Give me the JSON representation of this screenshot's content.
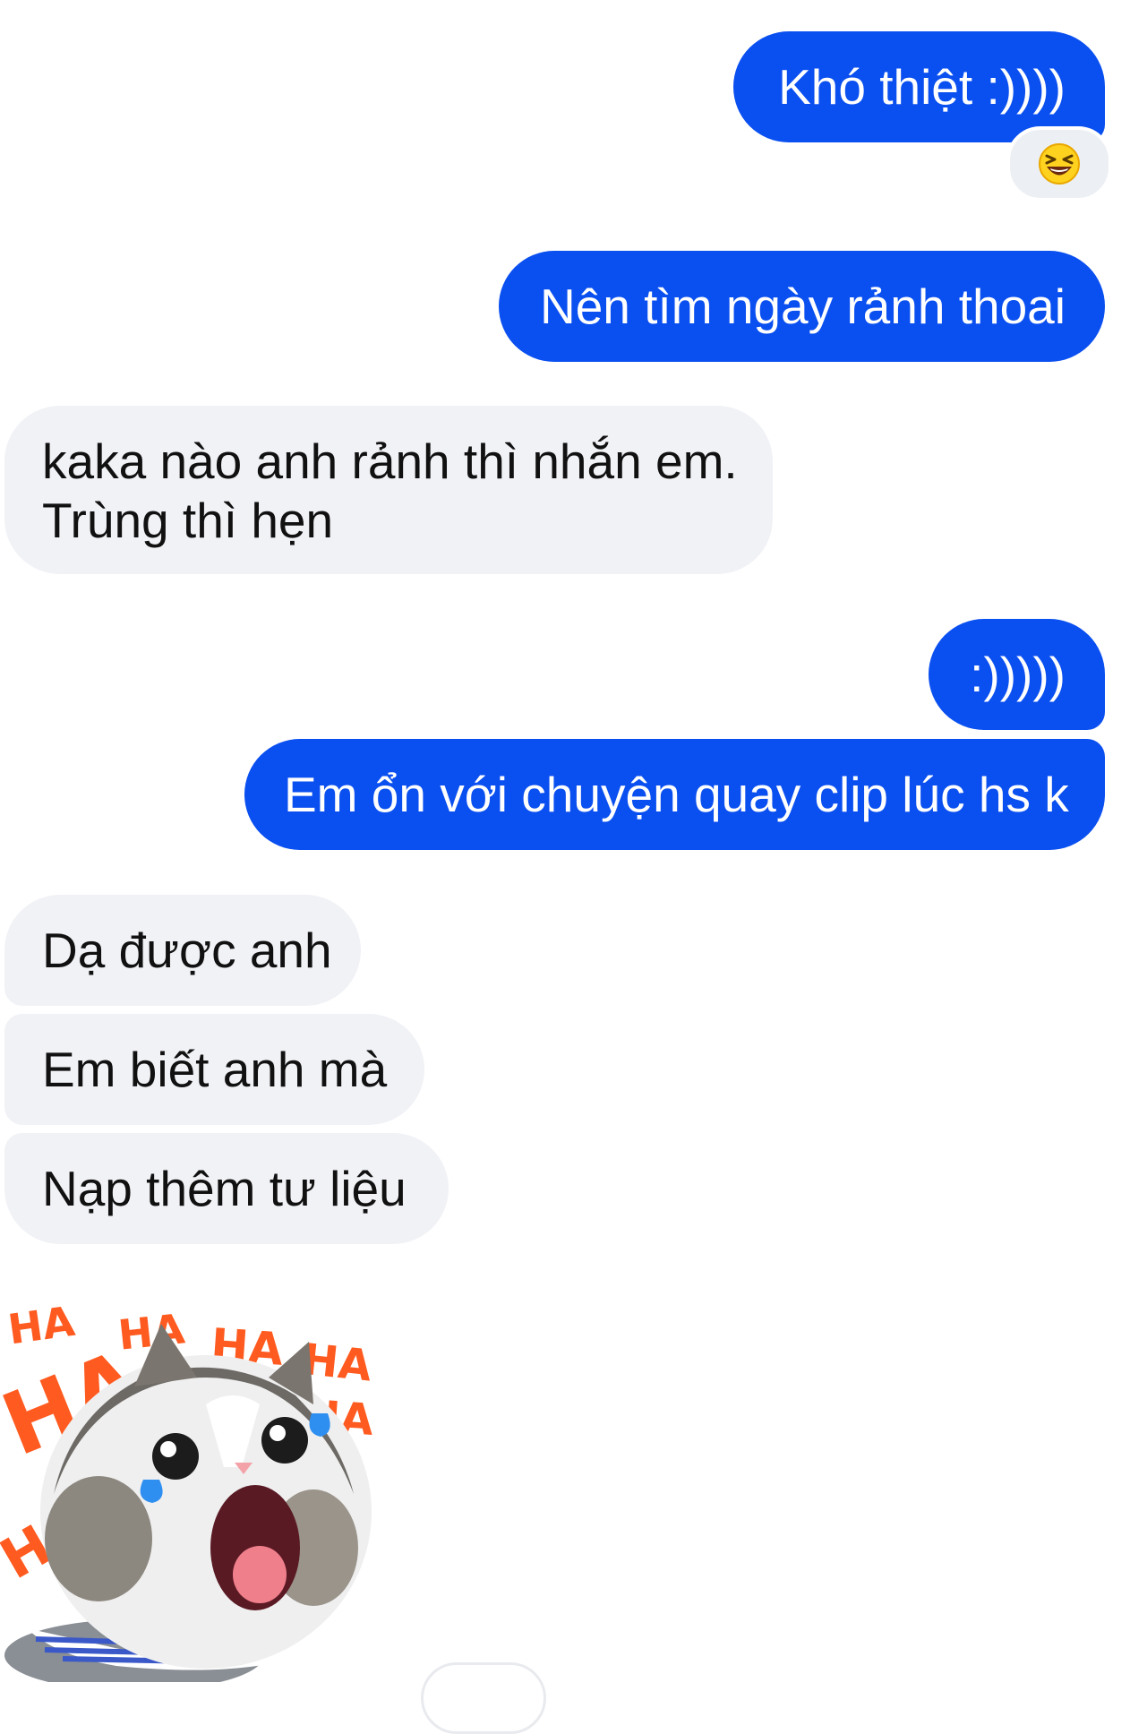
{
  "messages": [
    {
      "id": "m1",
      "direction": "outgoing",
      "text": "Khó thiệt :))))"
    },
    {
      "id": "m2",
      "direction": "outgoing",
      "text": "Nên tìm ngày rảnh thoai"
    },
    {
      "id": "m3",
      "direction": "incoming",
      "lines": [
        "kaka nào anh rảnh thì nhắn em.",
        "Trùng thì hẹn"
      ]
    },
    {
      "id": "m4",
      "direction": "outgoing",
      "text": ":)))))"
    },
    {
      "id": "m5",
      "direction": "outgoing",
      "text": "Em ổn với chuyện quay clip lúc hs k"
    },
    {
      "id": "m6",
      "direction": "incoming",
      "text": "Dạ được anh"
    },
    {
      "id": "m7",
      "direction": "incoming",
      "text": "Em biết anh mà"
    },
    {
      "id": "m8",
      "direction": "incoming",
      "text": "Nạp thêm tư liệu"
    }
  ],
  "reaction": {
    "icon": "laughing-emoji-icon",
    "on_message": "m1"
  },
  "sticker": {
    "icon": "laughing-cat-sticker-icon",
    "words": [
      "HA",
      "HA",
      "HA",
      "HA",
      "HA",
      "HA",
      "HA"
    ]
  },
  "colors": {
    "outgoing_bubble": "#0a4ff0",
    "incoming_bubble": "#f1f2f6",
    "sticker_text": "#ff5a1f"
  }
}
